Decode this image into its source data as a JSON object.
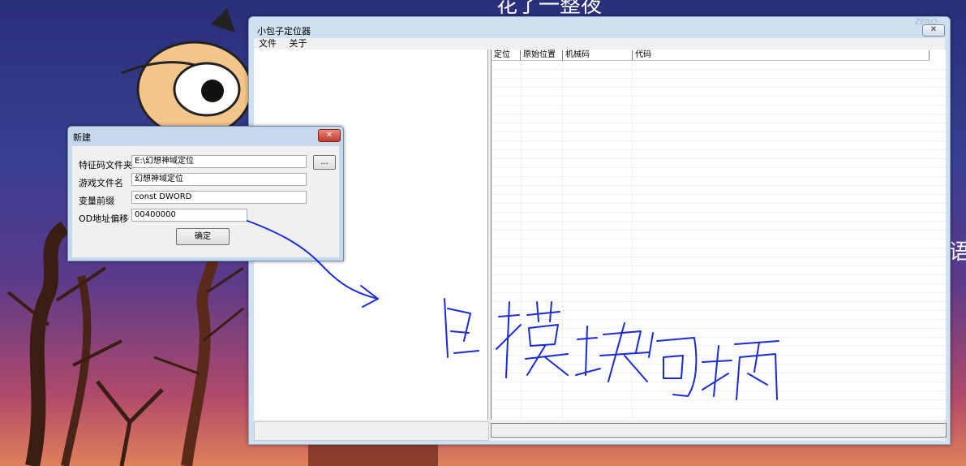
{
  "wallpaper": {
    "text_top": "花了一整夜",
    "text_right": "语"
  },
  "main_window": {
    "title": "小包子定位器",
    "watermark": "ZERO-",
    "close_label": "✕",
    "menu": [
      "文件",
      "关于"
    ],
    "grid_columns": [
      "定位",
      "原始位置",
      "机械码",
      "代码"
    ]
  },
  "dialog": {
    "title": "新建",
    "close_label": "✕",
    "fields": [
      {
        "label": "特征码文件夹",
        "value": "E:\\幻想神域定位"
      },
      {
        "label": "游戏文件名",
        "value": "幻想神域定位"
      },
      {
        "label": "变量前缀",
        "value": "const DWORD"
      },
      {
        "label": "OD地址偏移",
        "value": "00400000"
      }
    ],
    "browse_label": "...",
    "ok_label": "确定"
  },
  "annotation": {
    "handwritten": "写模块句柄",
    "color": "#1a2bd6"
  }
}
